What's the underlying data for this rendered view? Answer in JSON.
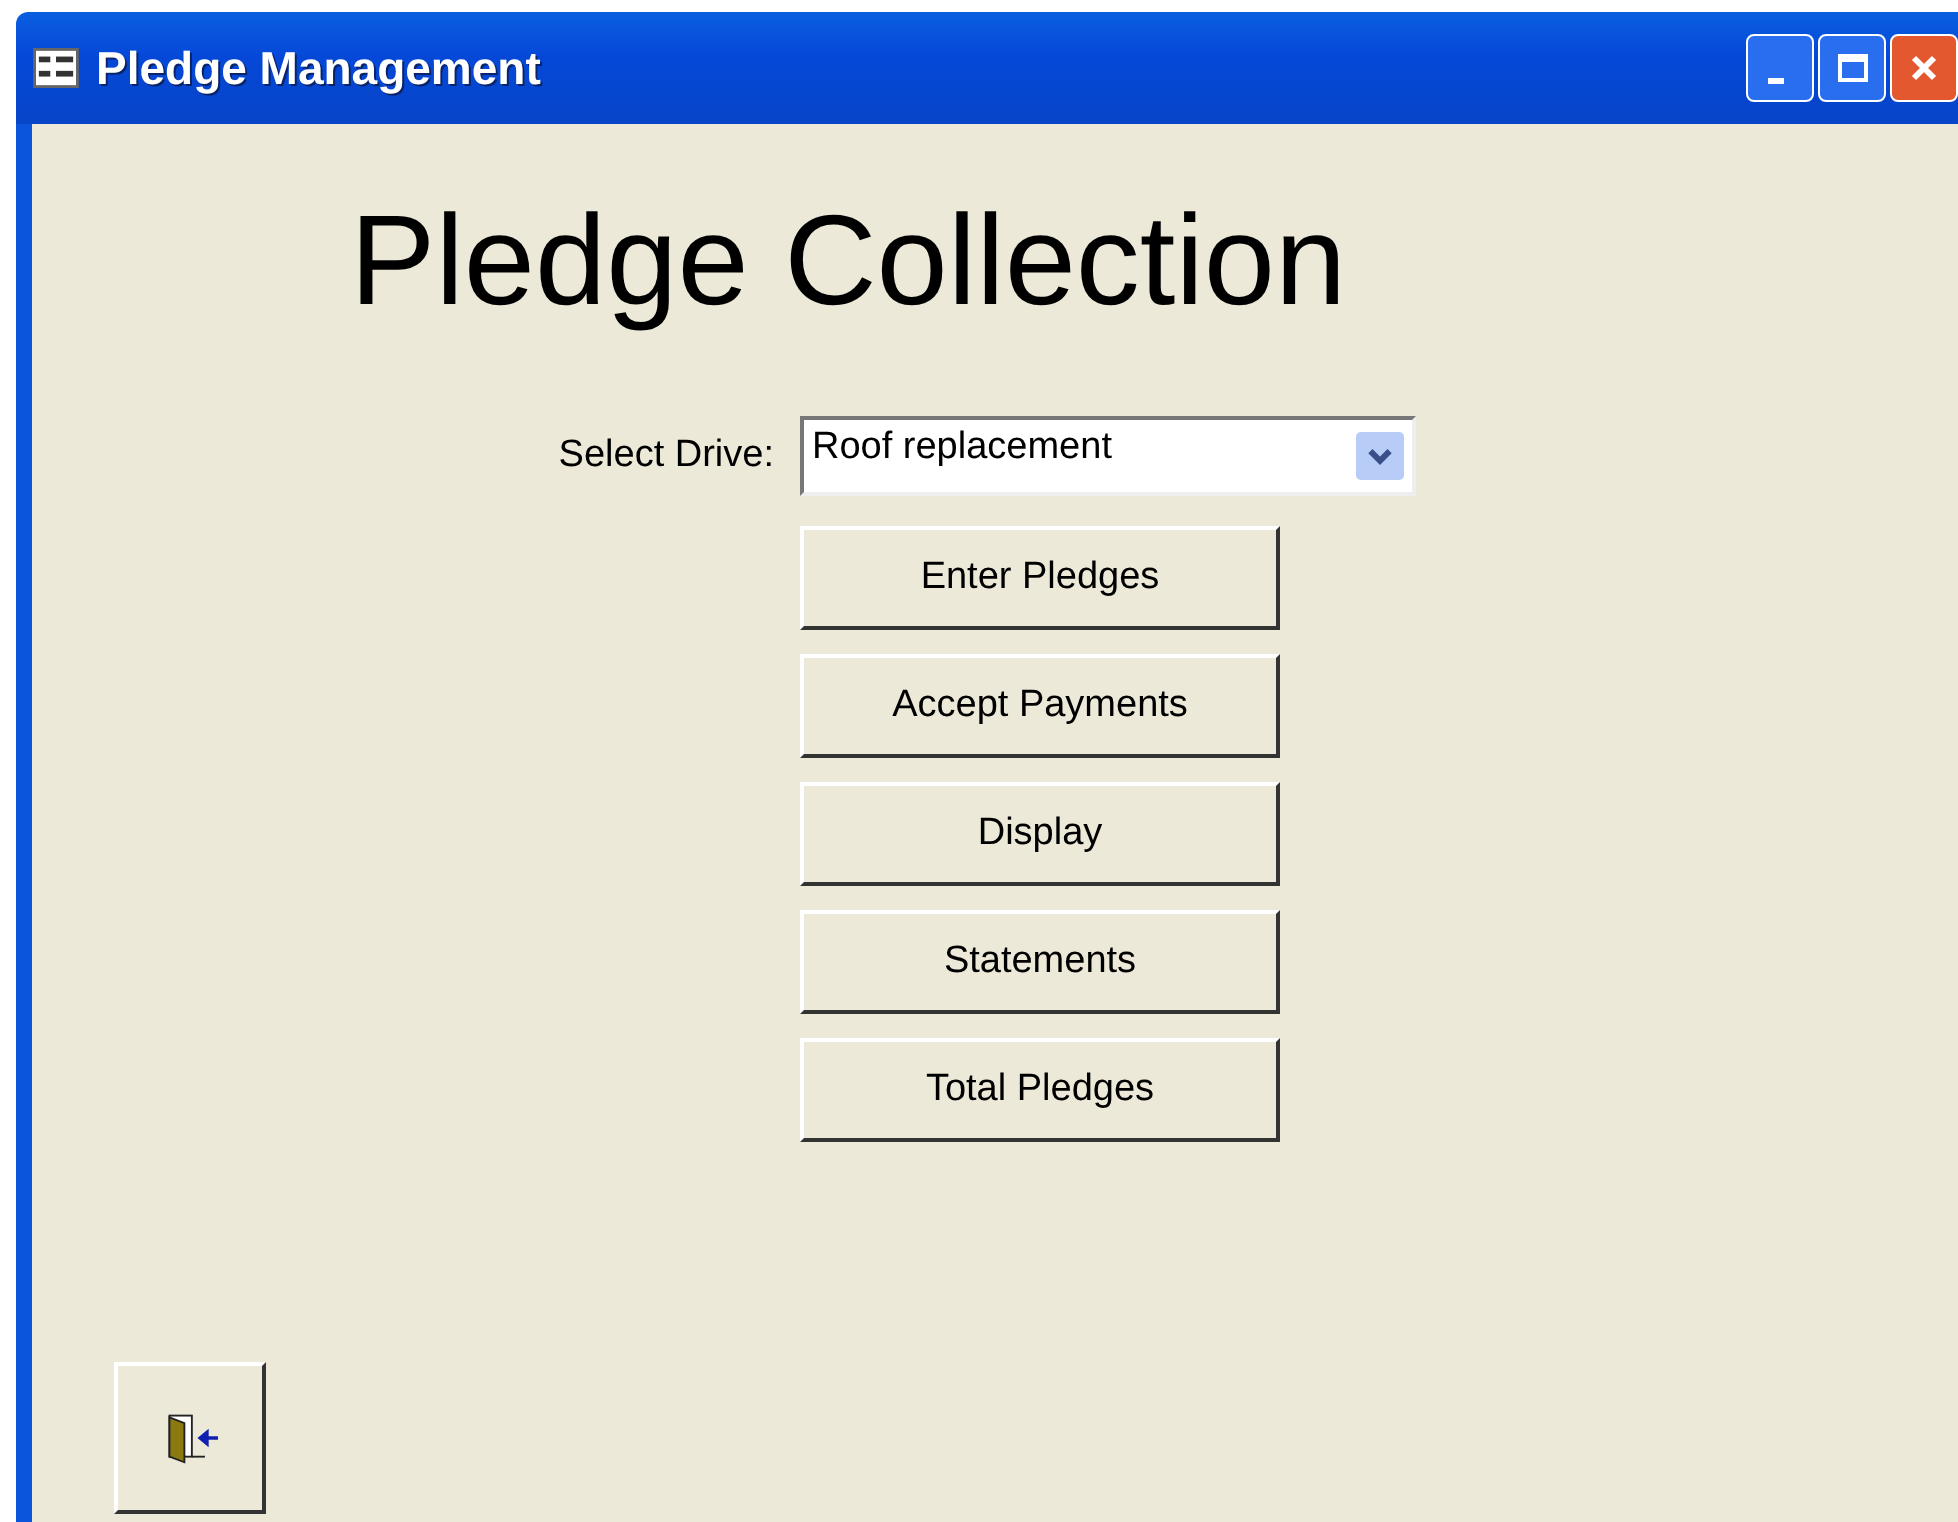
{
  "window": {
    "title": "Pledge Management"
  },
  "heading": "Pledge Collection",
  "drive_select": {
    "label": "Select Drive:",
    "value": "Roof replacement"
  },
  "buttons": [
    "Enter Pledges",
    "Accept Payments",
    "Display",
    "Statements",
    "Total Pledges"
  ]
}
